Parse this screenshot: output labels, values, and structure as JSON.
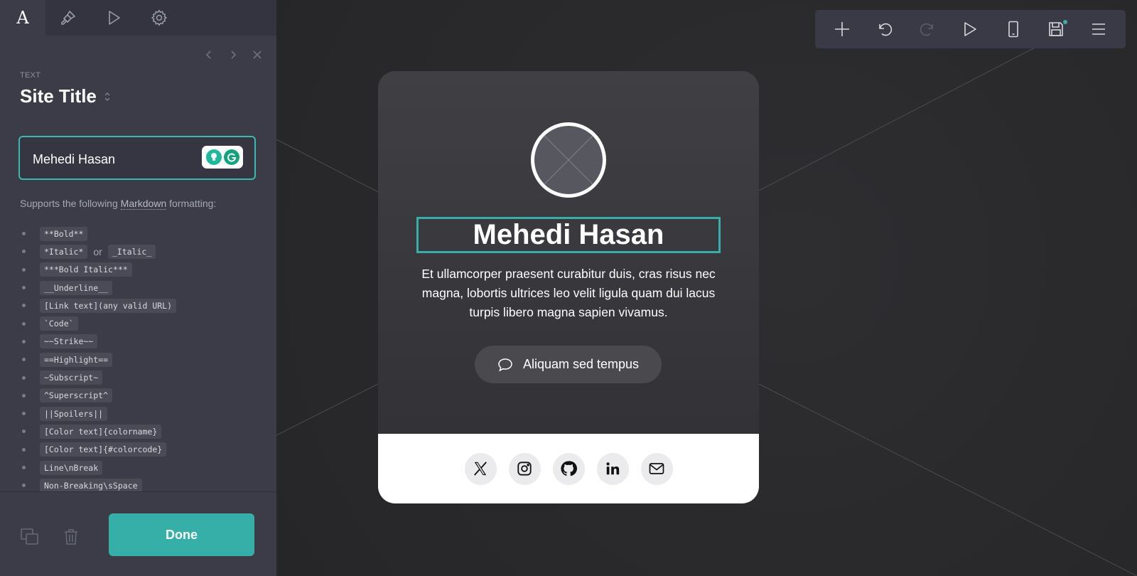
{
  "panel": {
    "tabs": [
      {
        "name": "text-tab",
        "glyph": "A"
      },
      {
        "name": "style-tab",
        "icon": "paintbrush-icon"
      },
      {
        "name": "animation-tab",
        "icon": "play-icon"
      },
      {
        "name": "settings-tab",
        "icon": "gear-icon"
      }
    ],
    "section_label": "TEXT",
    "section_title": "Site Title",
    "input_value": "Mehedi Hasan",
    "md_hint_prefix": "Supports the following",
    "md_hint_link": "Markdown",
    "md_hint_suffix": "formatting:",
    "markdown_items": [
      [
        "**Bold**"
      ],
      [
        "*Italic*",
        "or",
        "_Italic_"
      ],
      [
        "***Bold Italic***"
      ],
      [
        "__Underline__"
      ],
      [
        "[Link text](any valid URL)"
      ],
      [
        "`Code`"
      ],
      [
        "~~Strike~~"
      ],
      [
        "==Highlight=="
      ],
      [
        "~Subscript~"
      ],
      [
        "^Superscript^"
      ],
      [
        "||Spoilers||"
      ],
      [
        "[Color text]{colorname}"
      ],
      [
        "[Color text]{#colorcode}"
      ],
      [
        "Line\\nBreak"
      ],
      [
        "Non-Breaking\\sSpace"
      ]
    ],
    "done_label": "Done"
  },
  "toolbar": {
    "icons": [
      "plus-icon",
      "undo-icon",
      "redo-icon",
      "play-icon",
      "mobile-icon",
      "save-icon",
      "menu-icon"
    ]
  },
  "card": {
    "title": "Mehedi Hasan",
    "description": "Et ullamcorper praesent curabitur duis, cras risus nec magna, lobortis ultrices leo velit ligula quam dui lacus turpis libero magna sapien vivamus.",
    "cta_label": "Aliquam sed tempus",
    "social_icons": [
      "x-twitter-icon",
      "instagram-icon",
      "github-icon",
      "linkedin-icon",
      "email-icon"
    ]
  },
  "colors": {
    "accent": "#35afa8",
    "panel_bg": "#3b3c48",
    "canvas_bg": "#2a2a2d"
  }
}
